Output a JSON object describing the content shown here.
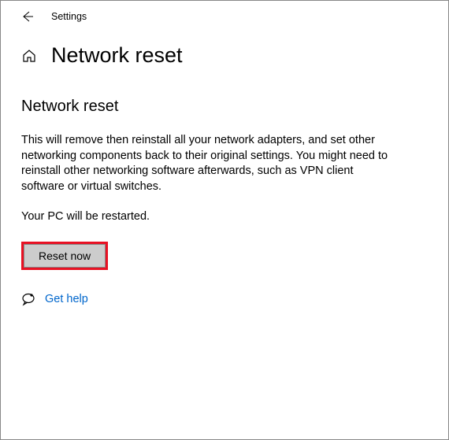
{
  "header": {
    "title": "Settings"
  },
  "page": {
    "heading": "Network reset",
    "subheading": "Network reset",
    "description": "This will remove then reinstall all your network adapters, and set other networking components back to their original settings. You might need to reinstall other networking software afterwards, such as VPN client software or virtual switches.",
    "restart_note": "Your PC will be restarted.",
    "reset_button": "Reset now",
    "help_link": "Get help"
  }
}
